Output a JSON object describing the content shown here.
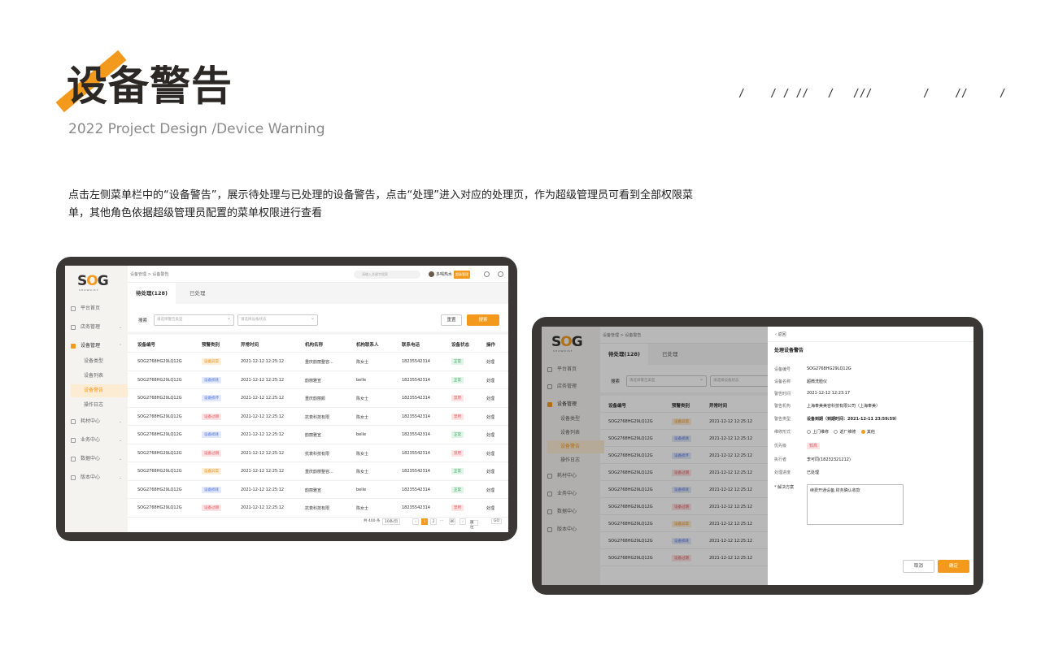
{
  "hero": {
    "title": "设备警告",
    "subtitle": "2022 Project Design /Device Warning",
    "slashes": "/    / / //   /   ///        /    //     /",
    "description": "点击左侧菜单栏中的“设备警告”，展示待处理与已处理的设备警告，点击“处理”进入对应的处理页，作为超级管理员可看到全部权限菜单，其他角色依据超级管理员配置的菜单权限进行查看"
  },
  "colors": {
    "accent": "#f39a1d",
    "frame": "#3a3734"
  },
  "app": {
    "logo": "SOG",
    "logo_sub": "SHOWDIST",
    "breadcrumb": "设备管理  >  设备警告",
    "search_placeholder": "请输入关键字搜索",
    "user_name": "多喝热水",
    "user_role": "超级管理",
    "menu": [
      {
        "label": "平台首页",
        "icon": "home-icon",
        "arrow": ""
      },
      {
        "label": "店务管理",
        "icon": "store-icon",
        "arrow": "⌄"
      },
      {
        "label": "设备管理",
        "icon": "device-icon",
        "arrow": "⌃"
      },
      {
        "label": "设备类型",
        "icon": "",
        "arrow": ""
      },
      {
        "label": "设备列表",
        "icon": "",
        "arrow": ""
      },
      {
        "label": "设备警告",
        "icon": "",
        "arrow": ""
      },
      {
        "label": "操作日志",
        "icon": "",
        "arrow": ""
      },
      {
        "label": "耗材中心",
        "icon": "supplies-icon",
        "arrow": "⌄"
      },
      {
        "label": "业务中心",
        "icon": "business-icon",
        "arrow": "⌄"
      },
      {
        "label": "数据中心",
        "icon": "data-icon",
        "arrow": "⌄"
      },
      {
        "label": "版本中心",
        "icon": "version-icon",
        "arrow": "⌄"
      }
    ],
    "tabs": [
      "待处理(128)",
      "已处理"
    ],
    "filter": {
      "label": "搜索",
      "select1": "请选择警告类型",
      "select2": "请选择设备状态",
      "reset": "重置",
      "search": "搜索"
    },
    "columns": [
      "设备编号",
      "预警类别",
      "异常时间",
      "机构名称",
      "机构联系人",
      "联系电话",
      "设备状态",
      "操作"
    ],
    "rows": [
      {
        "id": "SOG2768HG29LQ12G",
        "type": "设备异常",
        "tc": "o",
        "time": "2021-12-12  12:25:12",
        "org": "重庆韵丽整容...",
        "contact": "陈女士",
        "phone": "18235542314",
        "status": "正常",
        "sc": "g",
        "op": "处理"
      },
      {
        "id": "SOG2768HG29LQ12G",
        "type": "设备损耗",
        "tc": "b",
        "time": "2021-12-12  12:25:12",
        "org": "韵丽雅宣",
        "contact": "belle",
        "phone": "18235542314",
        "status": "正常",
        "sc": "g",
        "op": "处理"
      },
      {
        "id": "SOG2768HG29LQ12G",
        "type": "设备损坏",
        "tc": "b",
        "time": "2021-12-12  12:25:12",
        "org": "重庆韵丽颜",
        "contact": "陈女士",
        "phone": "18235542314",
        "status": "禁用",
        "sc": "r",
        "op": "处理"
      },
      {
        "id": "SOG2768HG29LQ12G",
        "type": "设备过期",
        "tc": "r",
        "time": "2021-12-12  12:25:12",
        "org": "抗衰科技有限",
        "contact": "陈女士",
        "phone": "18235542314",
        "status": "禁用",
        "sc": "r",
        "op": "处理"
      },
      {
        "id": "SOG2768HG29LQ12G",
        "type": "设备损耗",
        "tc": "b",
        "time": "2021-12-12  12:25:12",
        "org": "韵丽雅宣",
        "contact": "belle",
        "phone": "18235542314",
        "status": "正常",
        "sc": "g",
        "op": "处理"
      },
      {
        "id": "SOG2768HG29LQ12G",
        "type": "设备过期",
        "tc": "r",
        "time": "2021-12-12  12:25:12",
        "org": "抗衰科技有限",
        "contact": "陈女士",
        "phone": "18235542314",
        "status": "禁用",
        "sc": "r",
        "op": "处理"
      },
      {
        "id": "SOG2768HG29LQ12G",
        "type": "设备异常",
        "tc": "o",
        "time": "2021-12-12  12:25:12",
        "org": "重庆韵丽整容...",
        "contact": "陈女士",
        "phone": "18235542314",
        "status": "正常",
        "sc": "g",
        "op": "处理"
      },
      {
        "id": "SOG2768HG29LQ12G",
        "type": "设备损耗",
        "tc": "b",
        "time": "2021-12-12  12:25:12",
        "org": "韵丽雅宣",
        "contact": "belle",
        "phone": "18235542314",
        "status": "正常",
        "sc": "g",
        "op": "处理"
      },
      {
        "id": "SOG2768HG29LQ12G",
        "type": "设备过期",
        "tc": "r",
        "time": "2021-12-12  12:25:12",
        "org": "抗衰科技有限",
        "contact": "陈女士",
        "phone": "18235542314",
        "status": "禁用",
        "sc": "r",
        "op": "处理"
      }
    ],
    "pager": {
      "total": "共 400 条",
      "size": "10条/页",
      "p1": "1",
      "p2": "2",
      "dots": "...",
      "last": "86",
      "goto": "前往",
      "page": "页",
      "go": "GO"
    }
  },
  "drawer": {
    "back": "返回",
    "title": "处理设备警告",
    "fields": [
      {
        "k": "设备编号",
        "v": "SOG2768HG29LQ12G"
      },
      {
        "k": "设备名称",
        "v": "超微洗脸仪"
      },
      {
        "k": "警告时间",
        "v": "2021-12-12  12:23:17"
      },
      {
        "k": "警告机构",
        "v": "上海奉美美容科技有限公司（上海奉美）"
      },
      {
        "k": "警告类型",
        "v": "设备到期（到期时间：2021-12-11  23:59:59）"
      }
    ],
    "method_label": "维修形式",
    "methods": [
      "上门维修",
      "返厂维修",
      "其他"
    ],
    "priority_label": "优先级",
    "priority": "较高",
    "executor_label": "执行者",
    "executor": "李可同(18232321212)",
    "progress_label": "处理进度",
    "progress": "已处理",
    "solution_label": "* 解决方案",
    "solution": "续费开通设备,财务确认收款",
    "cancel": "取消",
    "confirm": "确定"
  }
}
